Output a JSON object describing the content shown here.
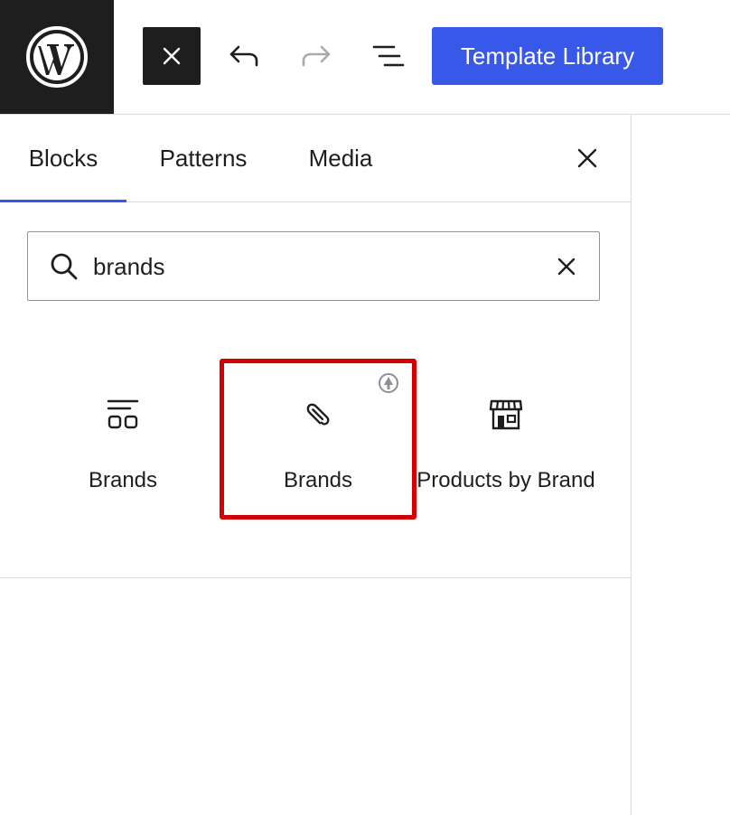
{
  "toolbar": {
    "logo_icon": "wordpress-logo-icon",
    "close_icon": "close-icon",
    "undo_icon": "undo-icon",
    "redo_icon": "redo-icon",
    "document_overview_icon": "list-view-icon",
    "template_library_label": "Template Library",
    "accent_color": "#3858e9"
  },
  "inserter": {
    "tabs": [
      {
        "label": "Blocks",
        "active": true
      },
      {
        "label": "Patterns",
        "active": false
      },
      {
        "label": "Media",
        "active": false
      }
    ],
    "search": {
      "value": "brands",
      "placeholder": "Search"
    },
    "results": [
      {
        "label": "Brands",
        "icon": "brands-grid-icon",
        "highlighted": false
      },
      {
        "label": "Brands",
        "icon": "paperclip-icon",
        "highlighted": true,
        "badge_icon": "plugin-badge-icon"
      },
      {
        "label": "Products by Brand",
        "icon": "storefront-icon",
        "highlighted": false
      }
    ],
    "highlight_color": "#d40000"
  }
}
